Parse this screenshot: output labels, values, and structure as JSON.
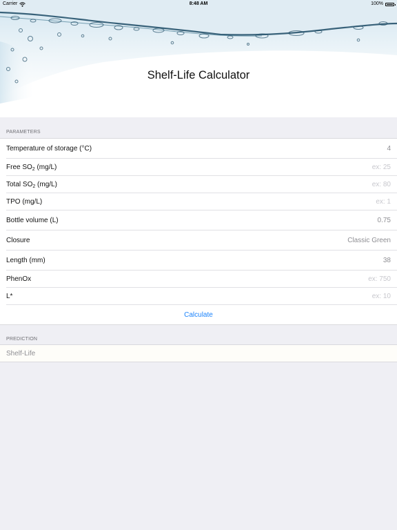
{
  "status_bar": {
    "carrier": "Carrier",
    "time": "8:48 AM",
    "battery": "100%",
    "battery_level": 1.0
  },
  "header": {
    "title": "Shelf-Life Calculator"
  },
  "parameters": {
    "section_title": "PARAMETERS",
    "rows": [
      {
        "label": "Temperature of storage (°C)",
        "value": "4",
        "placeholder": ""
      },
      {
        "label_main": "Free SO",
        "label_sub": "2",
        "label_unit": " (mg/L)",
        "value": "",
        "placeholder": "ex: 25"
      },
      {
        "label_main": "Total SO",
        "label_sub": "2",
        "label_unit": " (mg/L)",
        "value": "",
        "placeholder": "ex: 80"
      },
      {
        "label": "TPO (mg/L)",
        "value": "",
        "placeholder": "ex: 1"
      },
      {
        "label": "Bottle volume (L)",
        "value": "0.75",
        "placeholder": ""
      },
      {
        "label": "Closure",
        "value": "Classic Green"
      },
      {
        "label": "Length (mm)",
        "value": "38",
        "placeholder": ""
      },
      {
        "label": "PhenOx",
        "value": "",
        "placeholder": "ex: 750"
      },
      {
        "label": "L*",
        "value": "",
        "placeholder": "ex: 10"
      }
    ],
    "calculate_label": "Calculate"
  },
  "prediction": {
    "section_title": "PREDICTION",
    "label": "Shelf-Life"
  },
  "colors": {
    "accent": "#1a82fb",
    "background": "#efeff4",
    "water": "#1b4a64"
  }
}
